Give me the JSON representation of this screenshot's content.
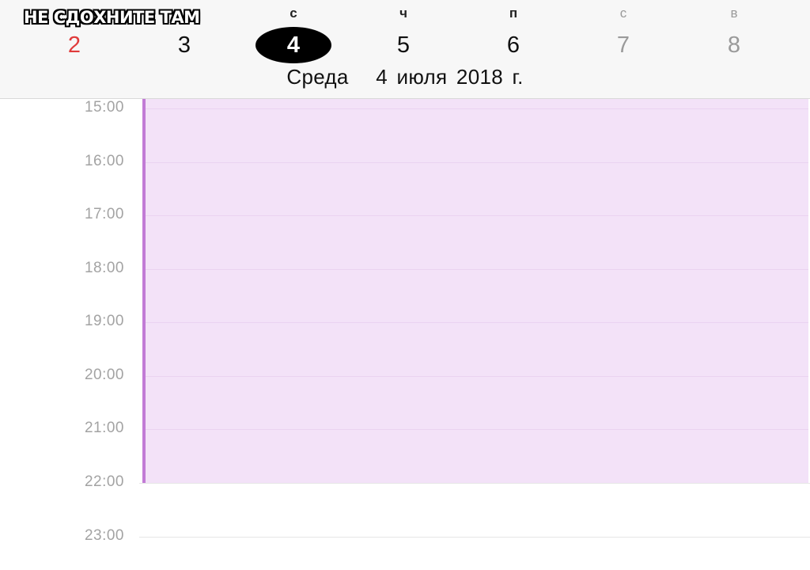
{
  "caption": "НЕ СДОХНИТЕ ТАМ",
  "week": {
    "days": [
      {
        "letter": "",
        "number": "2",
        "state": "sunday"
      },
      {
        "letter": "",
        "number": "3",
        "state": "normal"
      },
      {
        "letter": "с",
        "number": "4",
        "state": "selected"
      },
      {
        "letter": "ч",
        "number": "5",
        "state": "normal"
      },
      {
        "letter": "п",
        "number": "6",
        "state": "normal"
      },
      {
        "letter": "с",
        "number": "7",
        "state": "weekend"
      },
      {
        "letter": "в",
        "number": "8",
        "state": "weekend"
      }
    ],
    "weekday_name": "Среда",
    "date_text": "4 июля 2018 г."
  },
  "timeline": {
    "hours": [
      "15:00",
      "16:00",
      "17:00",
      "18:00",
      "19:00",
      "20:00",
      "21:00",
      "22:00",
      "23:00"
    ],
    "event": {
      "start": "14:45",
      "end": "22:00",
      "color": "#f3e2f8",
      "accent": "#c27bd6"
    }
  },
  "colors": {
    "sunday": "#e03b3b",
    "selected_bg": "#000000",
    "weekend": "#9a9a9a",
    "hour_label": "#a3a3a3"
  }
}
